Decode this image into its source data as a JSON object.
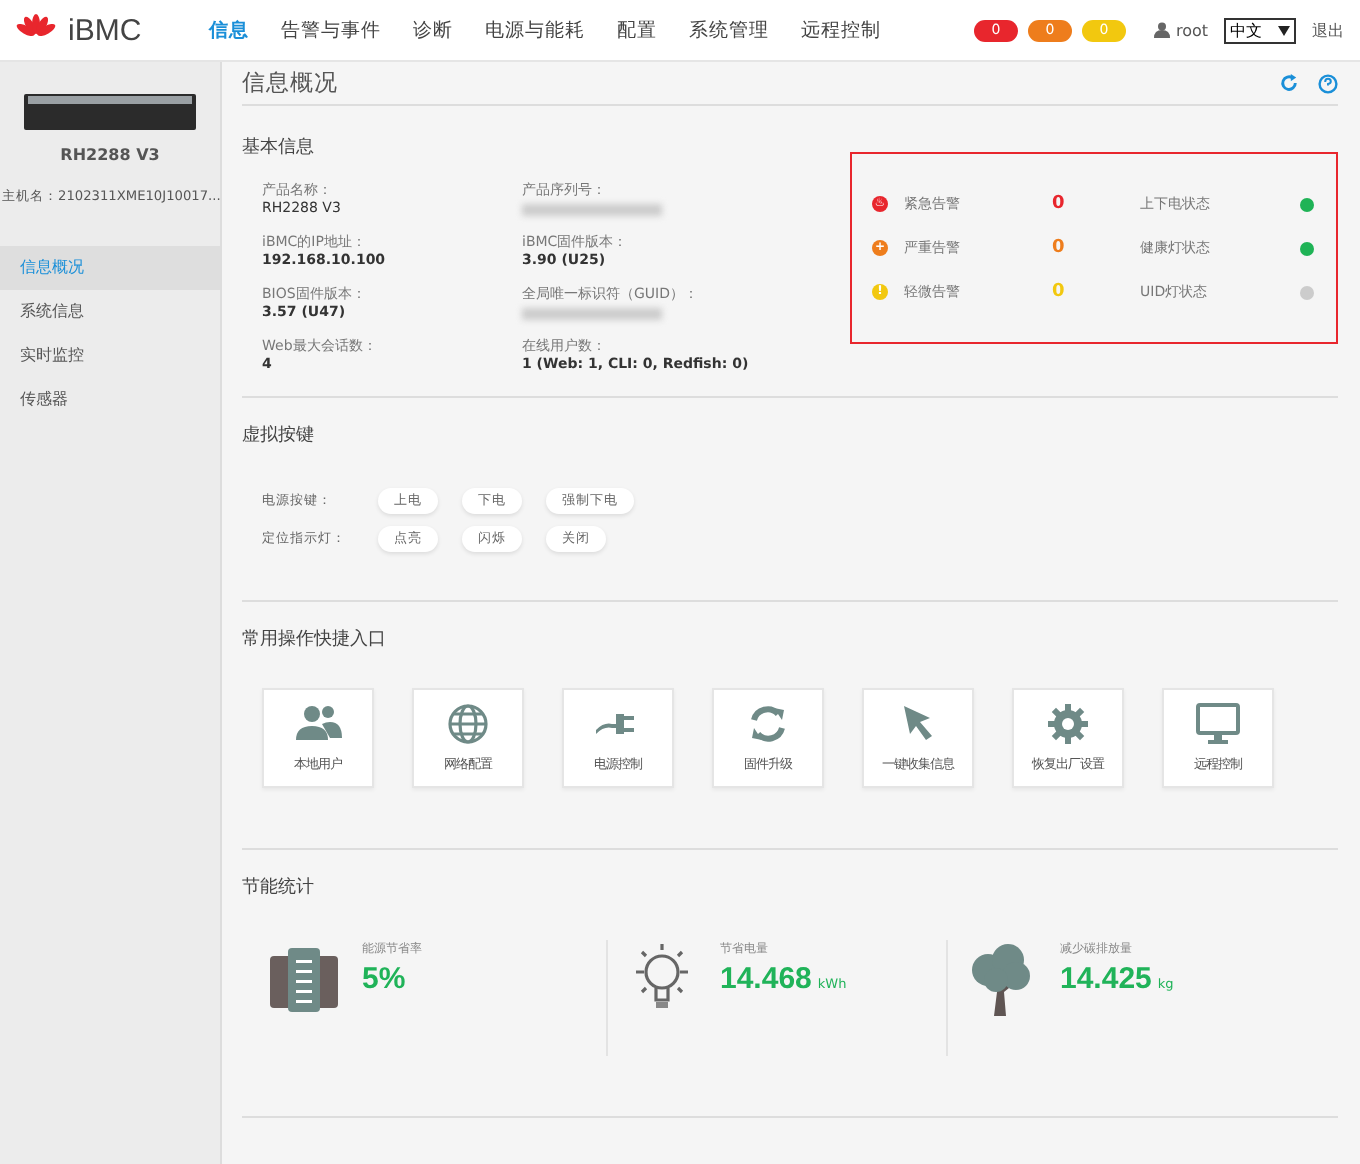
{
  "header": {
    "logo_text": "iBMC",
    "nav": [
      {
        "label": "信息",
        "selected": true
      },
      {
        "label": "告警与事件",
        "selected": false
      },
      {
        "label": "诊断",
        "selected": false
      },
      {
        "label": "电源与能耗",
        "selected": false
      },
      {
        "label": "配置",
        "selected": false
      },
      {
        "label": "系统管理",
        "selected": false
      },
      {
        "label": "远程控制",
        "selected": false
      }
    ],
    "alert_badges": [
      {
        "count": "0",
        "color": "#e8262d"
      },
      {
        "count": "0",
        "color": "#ee7d1c"
      },
      {
        "count": "0",
        "color": "#f2c80f"
      }
    ],
    "user": "root",
    "language": "中文",
    "logout": "退出"
  },
  "sidebar": {
    "model": "RH2288 V3",
    "hostname": "主机名：2102311XME10J10017...",
    "items": [
      {
        "label": "信息概况",
        "selected": true
      },
      {
        "label": "系统信息",
        "selected": false
      },
      {
        "label": "实时监控",
        "selected": false
      },
      {
        "label": "传感器",
        "selected": false
      }
    ]
  },
  "page_title": "信息概况",
  "basic_info": {
    "title": "基本信息",
    "fields": [
      {
        "label": "产品名称：",
        "value": "RH2288 V3",
        "kind": "plain"
      },
      {
        "label": "产品序列号：",
        "kind": "redacted"
      },
      {
        "label": "iBMC的IP地址：",
        "value": "192.168.10.100",
        "kind": "bold"
      },
      {
        "label": "iBMC固件版本：",
        "value": "3.90 (U25)",
        "kind": "bold"
      },
      {
        "label": "BIOS固件版本：",
        "value": "3.57 (U47)",
        "kind": "bold"
      },
      {
        "label": "全局唯一标识符（GUID）：",
        "kind": "redacted"
      },
      {
        "label": "Web最大会话数：",
        "value": "4",
        "kind": "bold"
      },
      {
        "label": "在线用户数：",
        "value": "1 (Web: 1, CLI: 0, Redfish: 0)",
        "kind": "bold"
      }
    ],
    "alerts": [
      {
        "label": "紧急告警",
        "count": "0",
        "color": "#e8262d",
        "glyph": "♨"
      },
      {
        "label": "严重告警",
        "count": "0",
        "color": "#ee7d1c",
        "glyph": "+"
      },
      {
        "label": "轻微告警",
        "count": "0",
        "color": "#f2c80f",
        "glyph": "!"
      }
    ],
    "states": [
      {
        "label": "上下电状态",
        "color": "#1fb356"
      },
      {
        "label": "健康灯状态",
        "color": "#1fb356"
      },
      {
        "label": "UID灯状态",
        "color": "#cccccc"
      }
    ]
  },
  "virtual_keys": {
    "title": "虚拟按键",
    "rows": [
      {
        "label": "电源按键：",
        "buttons": [
          "上电",
          "下电",
          "强制下电"
        ]
      },
      {
        "label": "定位指示灯：",
        "buttons": [
          "点亮",
          "闪烁",
          "关闭"
        ]
      }
    ]
  },
  "shortcuts": {
    "title": "常用操作快捷入口",
    "items": [
      {
        "label": "本地用户",
        "kind": "users"
      },
      {
        "label": "网络配置",
        "kind": "globe"
      },
      {
        "label": "电源控制",
        "kind": "plug"
      },
      {
        "label": "固件升级",
        "kind": "refresh"
      },
      {
        "label": "一键收集信息",
        "kind": "cursor"
      },
      {
        "label": "恢复出厂设置",
        "kind": "gear"
      },
      {
        "label": "远程控制",
        "kind": "monitor"
      }
    ]
  },
  "energy": {
    "title": "节能统计",
    "items": [
      {
        "label": "能源节省率",
        "value": "5%",
        "kind": "server"
      },
      {
        "label": "节省电量",
        "value": "14.468",
        "unit": "kWh",
        "kind": "bulb"
      },
      {
        "label": "减少碳排放量",
        "value": "14.425",
        "unit": "kg",
        "kind": "tree"
      }
    ]
  }
}
